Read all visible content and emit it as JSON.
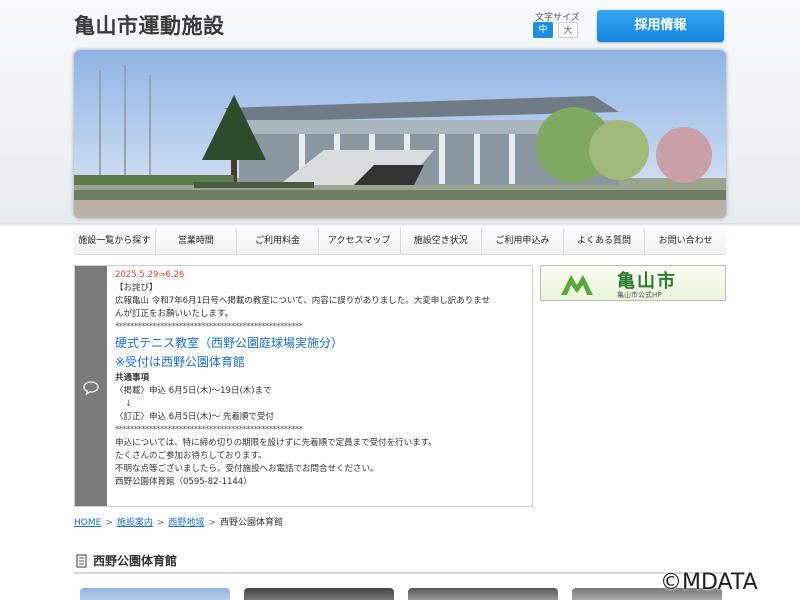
{
  "header": {
    "site_title": "亀山市運動施設",
    "font_size_label": "文字サイズ",
    "font_size_medium": "中",
    "font_size_large": "大",
    "recruit_button": "採用情報"
  },
  "nav": {
    "items": [
      {
        "label": "施設一覧から探す"
      },
      {
        "label": "営業時間"
      },
      {
        "label": "ご利用料金"
      },
      {
        "label": "アクセスマップ"
      },
      {
        "label": "施設空き状況"
      },
      {
        "label": "ご利用申込み"
      },
      {
        "label": "よくある質問"
      },
      {
        "label": "お問い合わせ"
      }
    ]
  },
  "notice": {
    "date": "2025.5.29⇒6.26",
    "apology_title": "【お詫び】",
    "apology_text_1": "広報亀山 令和7年6月1日号へ掲載の教室について、内容に誤りがありました。大変申し訳ありませ",
    "apology_text_2": "んが訂正をお願いいたします。",
    "stars": "**************************************************",
    "course_title": "硬式テニス教室（西野公園庭球場実施分）",
    "course_note": "※受付は西野公園体育館",
    "common_label": "共通事項",
    "published": "〈掲載〉申込 6月5日(木)～19日(木)まで",
    "arrow": "↓",
    "corrected": "〈訂正〉申込 6月5日(木)～ 先着順で受付",
    "info_1": "申込については、特に締め切りの期限を設けずに先着順で定員まで受付を行います。",
    "info_2": "たくさんのご参加お待ちしております。",
    "info_3": "不明な点等ございましたら、受付施設へお電話でお問合せください。",
    "contact": "西野公園体育館（0595-82-1144）"
  },
  "side_banner": {
    "city_name": "亀山市",
    "city_sub": "亀山市公式HP"
  },
  "breadcrumb": {
    "items": [
      "HOME",
      "施設案内",
      "西野地域",
      "西野公園体育館"
    ],
    "separator": ">"
  },
  "section": {
    "title": "西野公園体育館"
  },
  "watermark": "©MDATA",
  "colors": {
    "accent": "#1487dd",
    "date_red": "#d9453a",
    "link_blue": "#1f6fcc",
    "city_green": "#2f7a36"
  },
  "icons": {
    "notice": "speech-bubble-icon",
    "section": "document-icon",
    "city_logo": "mountain-logo-icon"
  }
}
